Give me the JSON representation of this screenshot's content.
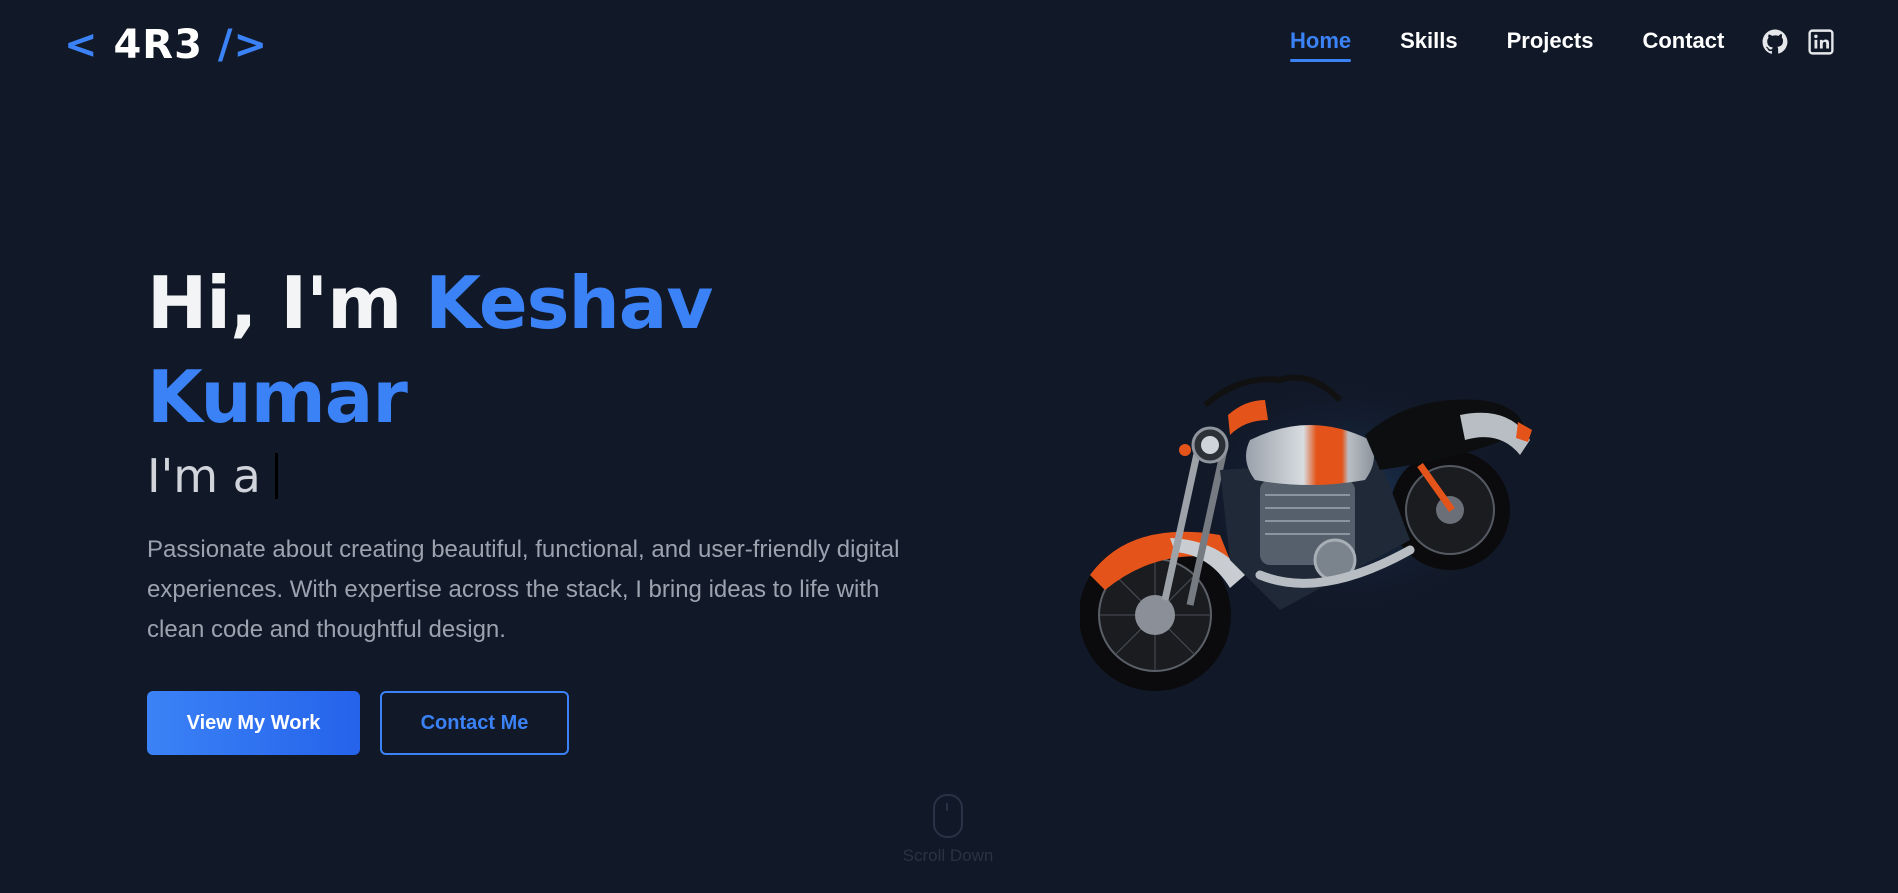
{
  "logo": {
    "open": "<",
    "name": "4R3",
    "close": "/>"
  },
  "nav": {
    "links": [
      {
        "label": "Home",
        "active": true
      },
      {
        "label": "Skills",
        "active": false
      },
      {
        "label": "Projects",
        "active": false
      },
      {
        "label": "Contact",
        "active": false
      }
    ],
    "social": [
      "github-icon",
      "linkedin-icon"
    ]
  },
  "hero": {
    "greeting": "Hi, I'm",
    "first_name": "Keshav",
    "last_name": "Kumar",
    "role_prefix": "I'm a",
    "description": "Passionate about creating beautiful, functional, and user-friendly digital experiences. With expertise across the stack, I bring ideas to life with clean code and thoughtful design.",
    "primary_button": "View My Work",
    "secondary_button": "Contact Me"
  },
  "scroll": {
    "label": "Scroll Down"
  },
  "colors": {
    "background": "#111827",
    "accent": "#3b82f6",
    "text": "#f3f4f6",
    "muted": "#9ca3af"
  }
}
